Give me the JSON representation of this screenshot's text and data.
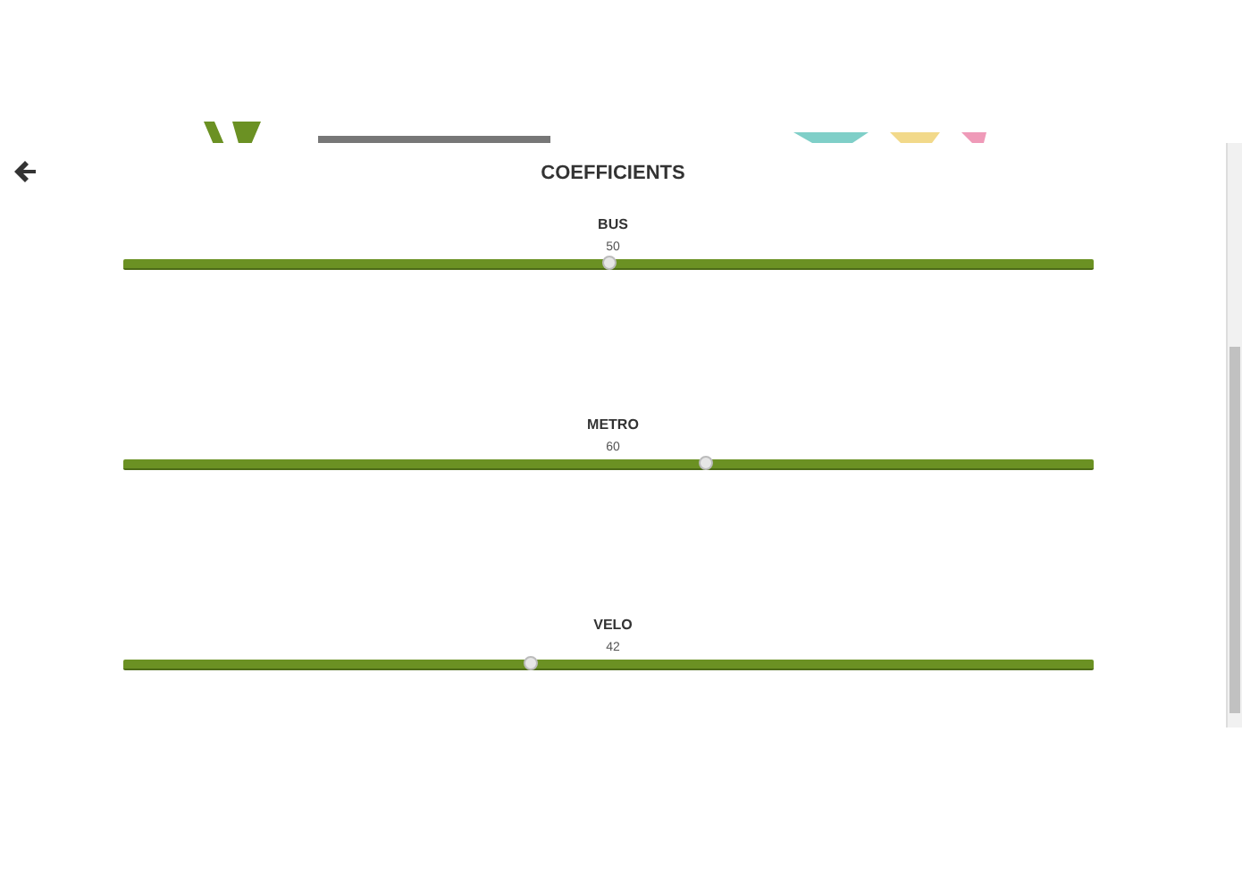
{
  "header": {
    "title": "COEFFICIENTS"
  },
  "sliders": [
    {
      "label": "BUS",
      "reading": "50",
      "level": 0.5
    },
    {
      "label": "METRO",
      "reading": "60",
      "level": 0.6
    },
    {
      "label": "VELO",
      "reading": "42",
      "level": 0.42
    }
  ]
}
